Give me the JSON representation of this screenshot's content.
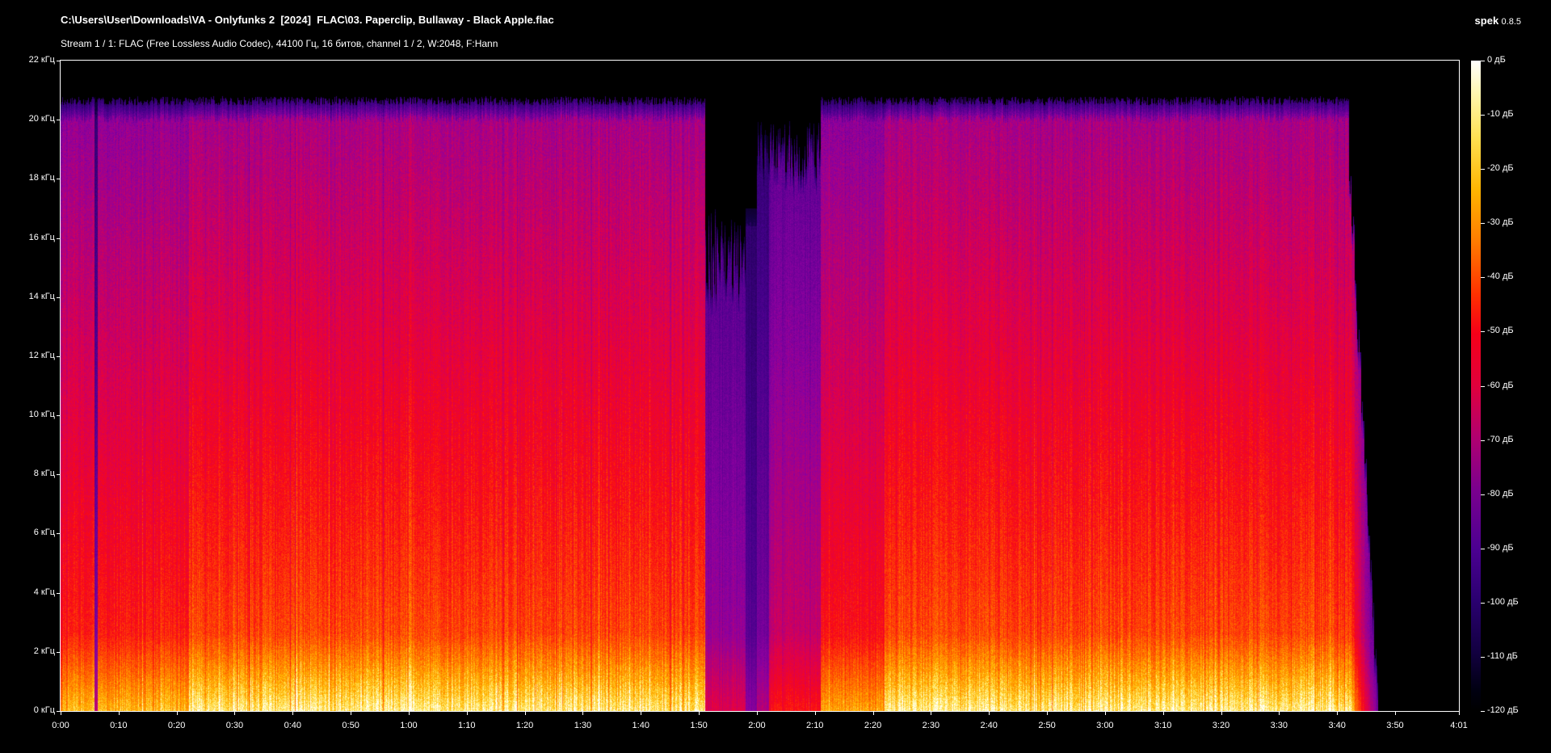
{
  "header": {
    "file_path": "C:\\Users\\User\\Downloads\\VA - Onlyfunks 2  [2024]  FLAC\\03. Paperclip, Bullaway - Black Apple.flac",
    "stream_info": "Stream 1 / 1: FLAC (Free Lossless Audio Codec), 44100 Гц, 16 битов, channel 1 / 2, W:2048, F:Hann",
    "app_name": "spek",
    "app_version": "0.8.5"
  },
  "frequency_axis": {
    "labels": [
      "22 кГц",
      "20 кГц",
      "18 кГц",
      "16 кГц",
      "14 кГц",
      "12 кГц",
      "10 кГц",
      "8 кГц",
      "6 кГц",
      "4 кГц",
      "2 кГц",
      "0 кГц"
    ],
    "values_khz": [
      22,
      20,
      18,
      16,
      14,
      12,
      10,
      8,
      6,
      4,
      2,
      0
    ],
    "max_khz": 22
  },
  "time_axis": {
    "labels": [
      "0:00",
      "0:10",
      "0:20",
      "0:30",
      "0:40",
      "0:50",
      "1:00",
      "1:10",
      "1:20",
      "1:30",
      "1:40",
      "1:50",
      "2:00",
      "2:10",
      "2:20",
      "2:30",
      "2:40",
      "2:50",
      "3:00",
      "3:10",
      "3:20",
      "3:30",
      "3:40",
      "3:50",
      "4:01"
    ],
    "values_sec": [
      0,
      10,
      20,
      30,
      40,
      50,
      60,
      70,
      80,
      90,
      100,
      110,
      120,
      130,
      140,
      150,
      160,
      170,
      180,
      190,
      200,
      210,
      220,
      230,
      241
    ],
    "duration_sec": 241
  },
  "db_scale": {
    "labels": [
      "0 дБ",
      "-10 дБ",
      "-20 дБ",
      "-30 дБ",
      "-40 дБ",
      "-50 дБ",
      "-60 дБ",
      "-70 дБ",
      "-80 дБ",
      "-90 дБ",
      "-100 дБ",
      "-110 дБ",
      "-120 дБ"
    ],
    "values_db": [
      0,
      -10,
      -20,
      -30,
      -40,
      -50,
      -60,
      -70,
      -80,
      -90,
      -100,
      -110,
      -120
    ],
    "min_db": -120
  },
  "spectrogram": {
    "audio_end_sec": 222,
    "cutoff_khz": 20.8,
    "quiet_sections_sec": [
      [
        111,
        120
      ],
      [
        120,
        130
      ]
    ],
    "colors": [
      "#000000",
      "#1a0050",
      "#4a0090",
      "#9000a0",
      "#e00040",
      "#ff1010",
      "#ff6000",
      "#ffb000",
      "#ffff80",
      "#ffffff"
    ]
  }
}
